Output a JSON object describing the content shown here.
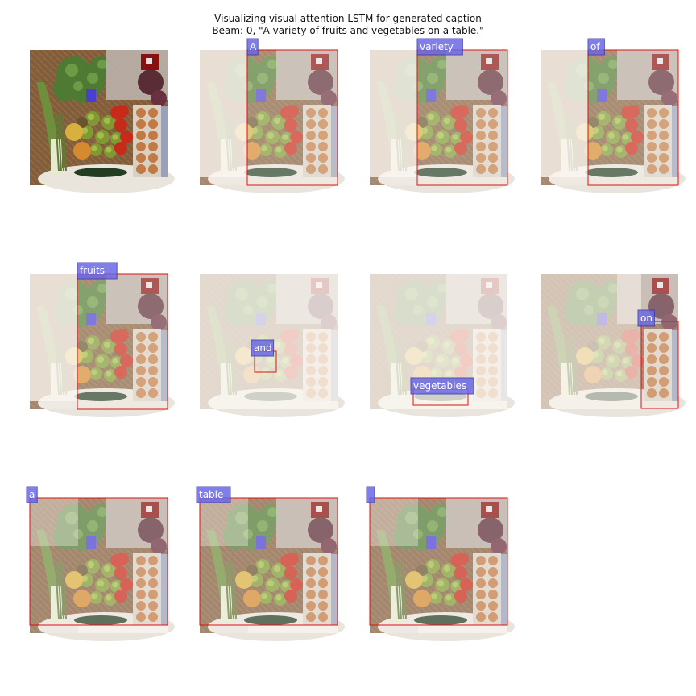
{
  "figure": {
    "title_line1": "Visualizing visual attention LSTM for generated caption",
    "title_line2": "Beam: 0, \"A variety of fruits and vegetables on a table.\""
  },
  "colors": {
    "box": "#dd1111",
    "label_bg": "#6a68e4",
    "label_border": "#3b3aa8",
    "label_text": "#ffffff"
  },
  "panels": [
    {
      "word": "",
      "attention": "none"
    },
    {
      "word": "A",
      "attention": "right"
    },
    {
      "word": "variety",
      "attention": "right"
    },
    {
      "word": "of",
      "attention": "right"
    },
    {
      "word": "fruits",
      "attention": "right"
    },
    {
      "word": "and",
      "attention": "center-small"
    },
    {
      "word": "vegetables",
      "attention": "bottom-center"
    },
    {
      "word": "on",
      "attention": "right-edge"
    },
    {
      "word": "a",
      "attention": "full"
    },
    {
      "word": "table",
      "attention": "full"
    },
    {
      "word": "",
      "attention": "full"
    }
  ]
}
